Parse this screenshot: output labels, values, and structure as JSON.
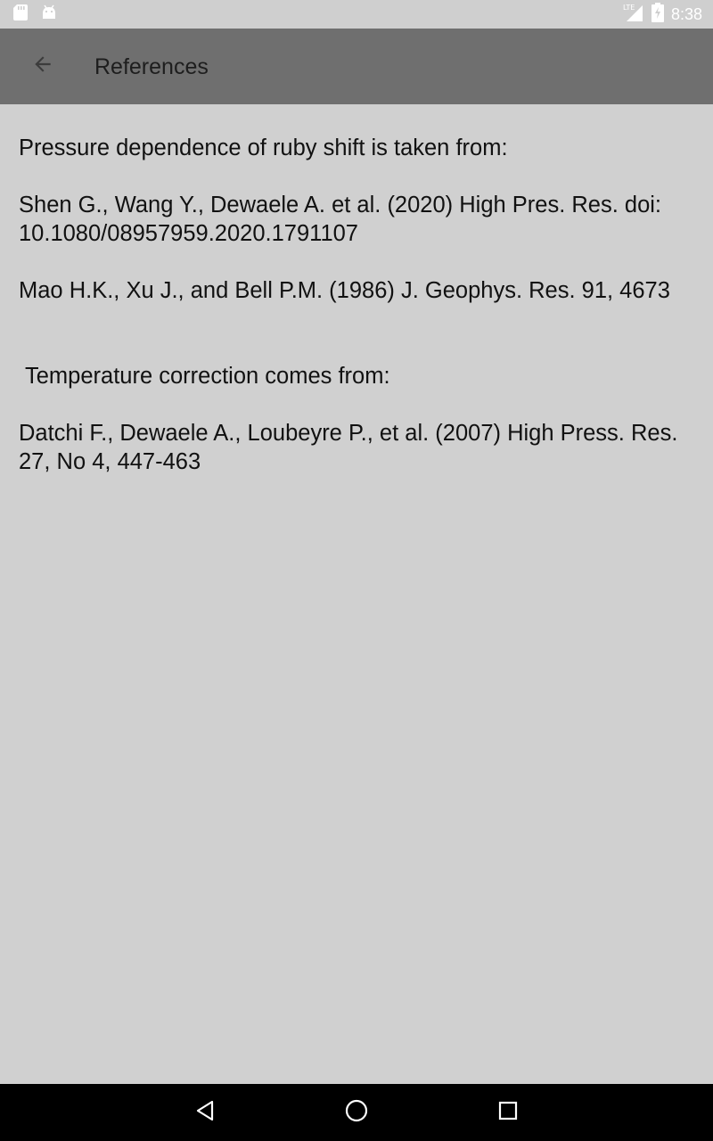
{
  "status_bar": {
    "time": "8:38",
    "icons": [
      "sd-card-icon",
      "android-icon",
      "lte-signal-icon",
      "battery-charging-icon"
    ]
  },
  "app_bar": {
    "title": "References",
    "back_icon": "arrow-back-icon"
  },
  "references": {
    "pressure_heading": "Pressure dependence of ruby shift is taken from:",
    "shen_ref": "Shen G., Wang Y., Dewaele A. et al. (2020) High Pres. Res. doi: 10.1080/08957959.2020.1791107",
    "mao_ref": "Mao H.K., Xu J., and Bell P.M. (1986) J. Geophys. Res. 91, 4673",
    "temperature_heading": "Temperature correction comes from:",
    "datchi_ref": "Datchi F., Dewaele A., Loubeyre P., et al. (2007) High Press. Res. 27, No 4, 447-463"
  },
  "nav_bar": {
    "icons": [
      "nav-back-icon",
      "nav-home-icon",
      "nav-recents-icon"
    ]
  }
}
